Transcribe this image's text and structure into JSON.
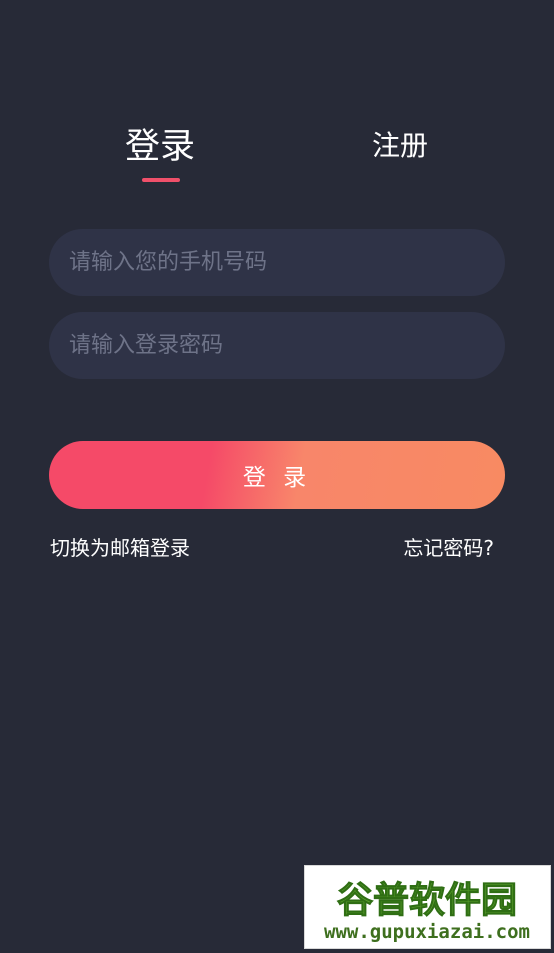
{
  "tabs": {
    "login": "登录",
    "register": "注册"
  },
  "form": {
    "phone_placeholder": "请输入您的手机号码",
    "password_placeholder": "请输入登录密码",
    "submit_label": "登 录"
  },
  "links": {
    "email_login": "切换为邮箱登录",
    "forgot_password": "忘记密码?"
  },
  "watermark": {
    "brand": "谷普软件园",
    "url": "www.gupuxiazai.com"
  },
  "colors": {
    "background": "#272a37",
    "input_background": "#2f3347",
    "accent": "#f0506a",
    "button_gradient_start": "#f54a68",
    "button_gradient_end": "#f88a62",
    "watermark_green": "#5aa02c"
  }
}
